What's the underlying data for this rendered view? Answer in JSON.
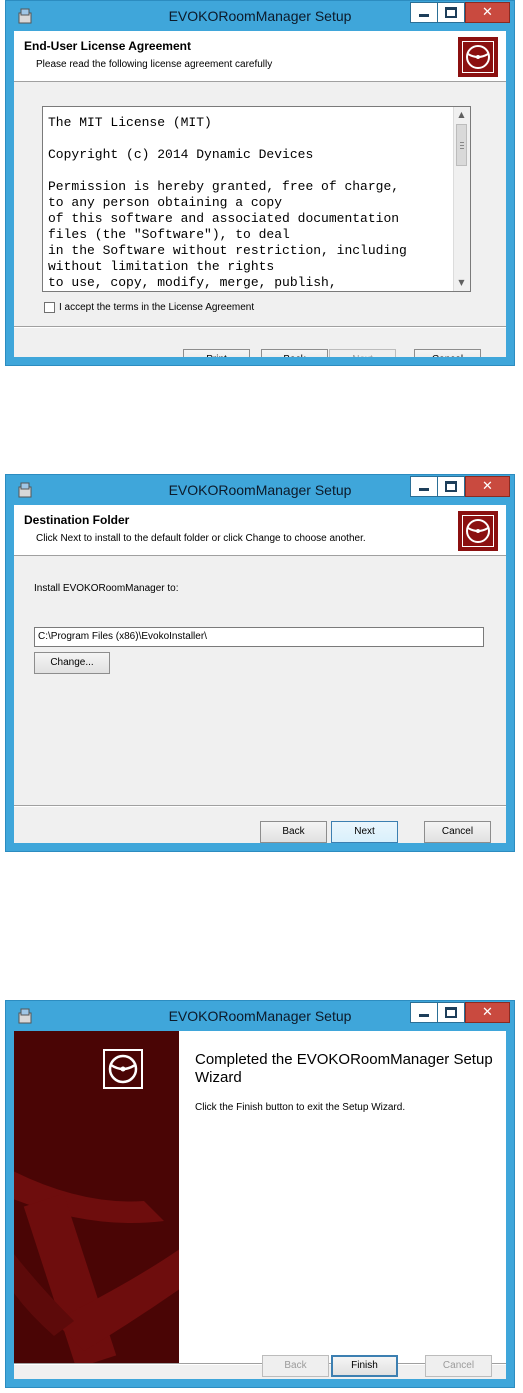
{
  "colors": {
    "titlebar": "#3fa6da",
    "close_button": "#c94a3f",
    "brand_red": "#8b1010",
    "panel_dark": "#4a0505"
  },
  "windows": [
    {
      "title": "EVOKORoomManager Setup",
      "icons": {
        "app": "installer-app-icon",
        "minimize": "minimize-icon",
        "maximize": "maximize-icon",
        "close": "close-icon",
        "logo": "disc-logo-icon"
      },
      "banner": {
        "title": "End-User License Agreement",
        "subtitle": "Please read the following license agreement carefully"
      },
      "license_lines": [
        "The MIT License (MIT)",
        "",
        "Copyright (c) 2014 Dynamic Devices",
        "",
        "Permission is hereby granted, free of charge,",
        "to any person obtaining a copy",
        "of this software and associated documentation",
        "files (the \"Software\"), to deal",
        "in the Software without restriction, including",
        "without limitation the rights",
        "to use, copy, modify, merge, publish,"
      ],
      "accept_label": "I accept the terms in the License Agreement",
      "accept_checked": false,
      "buttons": {
        "print": "Print",
        "back": "Back",
        "next": "Next",
        "cancel": "Cancel"
      }
    },
    {
      "title": "EVOKORoomManager Setup",
      "banner": {
        "title": "Destination Folder",
        "subtitle": "Click Next to install to the default folder or click Change to choose another."
      },
      "install_label": "Install EVOKORoomManager to:",
      "install_path": "C:\\Program Files (x86)\\EvokoInstaller\\",
      "change_label": "Change...",
      "buttons": {
        "back": "Back",
        "next": "Next",
        "cancel": "Cancel"
      }
    },
    {
      "title": "EVOKORoomManager Setup",
      "heading": "Completed the EVOKORoomManager Setup Wizard",
      "body": "Click the Finish button to exit the Setup Wizard.",
      "buttons": {
        "back": "Back",
        "finish": "Finish",
        "cancel": "Cancel"
      }
    }
  ]
}
